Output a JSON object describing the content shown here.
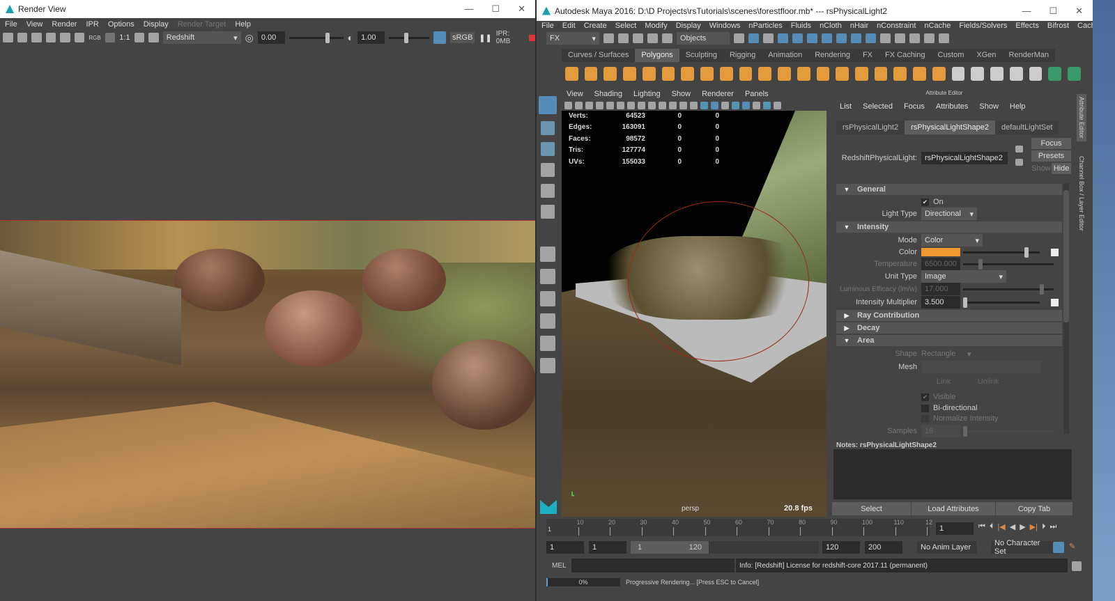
{
  "render_view": {
    "title": "Render View",
    "menu": [
      "File",
      "View",
      "Render",
      "IPR",
      "Options",
      "Display",
      "Render Target",
      "Help"
    ],
    "ratio": "1:1",
    "rgb": "RGB",
    "renderer": "Redshift",
    "exposure": "0.00",
    "gamma": "1.00",
    "colorspace": "sRGB",
    "ipr_mem": "IPR: 0MB"
  },
  "maya": {
    "title": "Autodesk Maya 2016: D:\\D Projects\\rsTutorials\\scenes\\forestfloor.mb*  ---  rsPhysicalLight2",
    "menu": [
      "File",
      "Edit",
      "Create",
      "Select",
      "Modify",
      "Display",
      "Windows",
      "nParticles",
      "Fluids",
      "nCloth",
      "nHair",
      "nConstraint",
      "nCache",
      "Fields/Solvers",
      "Effects",
      "Bifrost",
      "Cache"
    ],
    "menuset": "FX",
    "selection_mode": "Objects",
    "shelf_tabs": [
      "Curves / Surfaces",
      "Polygons",
      "Sculpting",
      "Rigging",
      "Animation",
      "Rendering",
      "FX",
      "FX Caching",
      "Custom",
      "XGen",
      "RenderMan"
    ],
    "active_shelf": "Polygons"
  },
  "viewport": {
    "menu": [
      "View",
      "Shading",
      "Lighting",
      "Show",
      "Renderer",
      "Panels"
    ],
    "stats": [
      {
        "label": "Verts:",
        "a": "64523",
        "b": "0",
        "c": "0"
      },
      {
        "label": "Edges:",
        "a": "163091",
        "b": "0",
        "c": "0"
      },
      {
        "label": "Faces:",
        "a": "98572",
        "b": "0",
        "c": "0"
      },
      {
        "label": "Tris:",
        "a": "127774",
        "b": "0",
        "c": "0"
      },
      {
        "label": "UVs:",
        "a": "155033",
        "b": "0",
        "c": "0"
      }
    ],
    "camera": "persp",
    "fps": "20.8 fps"
  },
  "attr": {
    "title": "Attribute Editor",
    "menu": [
      "List",
      "Selected",
      "Focus",
      "Attributes",
      "Show",
      "Help"
    ],
    "tabs": [
      "rsPhysicalLight2",
      "rsPhysicalLightShape2",
      "defaultLightSet"
    ],
    "node_label": "RedshiftPhysicalLight:",
    "node_name": "rsPhysicalLightShape2",
    "focus": "Focus",
    "presets": "Presets",
    "show": "Show",
    "hide": "Hide",
    "general": "General",
    "on": "On",
    "light_type_label": "Light Type",
    "light_type": "Directional",
    "intensity": "Intensity",
    "mode_label": "Mode",
    "mode": "Color",
    "color_label": "Color",
    "color": "#f0962e",
    "temp_label": "Temperature",
    "temp": "6500.000",
    "unit_label": "Unit Type",
    "unit": "Image",
    "lum_label": "Luminous Efficacy (lm/w)",
    "lum": "17.000",
    "mult_label": "Intensity Multiplier",
    "mult": "3.500",
    "ray": "Ray Contribution",
    "decay": "Decay",
    "area": "Area",
    "shape_label": "Shape",
    "shape": "Rectangle",
    "mesh_label": "Mesh",
    "link": "Link",
    "unlink": "Unlink",
    "visible": "Visible",
    "bidir": "Bi-directional",
    "normalize": "Normalize Intensity",
    "samples_label": "Samples",
    "samples": "16",
    "notes": "Notes:  rsPhysicalLightShape2",
    "select": "Select",
    "load": "Load Attributes",
    "copy": "Copy Tab",
    "side_tabs": [
      "Attribute Editor",
      "Channel Box / Layer Editor"
    ]
  },
  "timeline": {
    "ticks": [
      "10",
      "20",
      "30",
      "40",
      "50",
      "60",
      "70",
      "80",
      "90",
      "100",
      "110",
      "12"
    ],
    "current": "1",
    "start_tick": "1",
    "range_start": "1",
    "play_start": "1",
    "slider_start": "1",
    "slider_end": "120",
    "play_end": "120",
    "range_end": "200",
    "anim_layer": "No Anim Layer",
    "char_set": "No Character Set"
  },
  "cmd": {
    "lang": "MEL",
    "info": "Info:  [Redshift] License for redshift-core 2017.11 (permanent)"
  },
  "help": {
    "progress": "0%",
    "progress_value": 0,
    "message": "Progressive Rendering... [Press ESC to Cancel]"
  }
}
